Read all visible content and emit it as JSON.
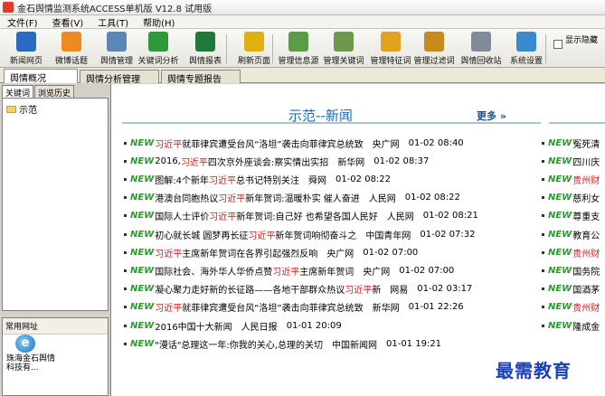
{
  "window": {
    "title": "金石舆情监测系统ACCESS单机版 V12.8 试用版"
  },
  "menu": [
    "文件(F)",
    "查看(V)",
    "工具(T)",
    "帮助(H)"
  ],
  "toolbar": [
    {
      "label": "新闻网页",
      "icon": "s-logo-icon",
      "color": "#2a6ac0"
    },
    {
      "label": "微博话题",
      "icon": "rss-icon",
      "color": "#ef8a1e"
    },
    {
      "label": "舆情管理",
      "icon": "monitor-icon",
      "color": "#5a87b8"
    },
    {
      "label": "关键词分析",
      "icon": "bar-chart-icon",
      "color": "#2e9a3a"
    },
    {
      "label": "舆情报表",
      "icon": "excel-icon",
      "color": "#1f7a3a"
    },
    {
      "label": "刷新页面",
      "icon": "star-icon",
      "color": "#e0b010"
    },
    {
      "label": "管理信息源",
      "icon": "database-icon",
      "color": "#5b9c46"
    },
    {
      "label": "管理关键词",
      "icon": "table-icon",
      "color": "#6b9b4a"
    },
    {
      "label": "管理特征词",
      "icon": "cards-icon",
      "color": "#e3a21c"
    },
    {
      "label": "管理过滤词",
      "icon": "folder-image-icon",
      "color": "#c88a1a"
    },
    {
      "label": "舆情回收站",
      "icon": "trash-icon",
      "color": "#7f8a9a"
    },
    {
      "label": "系统设置",
      "icon": "screen-icon",
      "color": "#3a8ad0"
    }
  ],
  "display_option": {
    "label": "显示隐藏"
  },
  "tabs": [
    "舆情概况",
    "舆情分析管理",
    "舆情专题报告"
  ],
  "left": {
    "tabs": [
      "关键词",
      "浏览历史"
    ],
    "tree": [
      "示范"
    ],
    "common_sites": {
      "title": "常用网址",
      "item": "珠海金石舆情科技有..."
    }
  },
  "main": {
    "heading": "示范--新闻",
    "more": "更多 »",
    "news": [
      {
        "pre": "",
        "hl": "习近平",
        "post": "就菲律宾遭受台风“洛坦”袭击向菲律宾总统致",
        "source": "央广网",
        "time": "01-02 08:40"
      },
      {
        "pre": "2016, ",
        "hl": "习近平",
        "post": "四次京外座谈会:察实情出实招",
        "source": "新华网",
        "time": "01-02 08:37"
      },
      {
        "pre": "图解:4个新年 ",
        "hl": "习近平",
        "post": "总书记特别关注",
        "source": "舜网",
        "time": "01-02 08:22"
      },
      {
        "pre": "港澳台同胞热议",
        "hl": "习近平",
        "post": "新年贺词:温暖朴实 催人奋进",
        "source": "人民网",
        "time": "01-02 08:22"
      },
      {
        "pre": "国际人士评价",
        "hl": "习近平",
        "post": "新年贺词:自己好 也希望各国人民好",
        "source": "人民网",
        "time": "01-02 08:21"
      },
      {
        "pre": "初心就长城 圆梦再长征 ",
        "hl": "习近平",
        "post": "新年贺词响彻奋斗之",
        "source": "中国青年网",
        "time": "01-02 07:32"
      },
      {
        "pre": "",
        "hl": "习近平",
        "post": "主席新年贺词在各界引起强烈反响",
        "source": "央广网",
        "time": "01-02 07:00"
      },
      {
        "pre": "国际社会、海外华人华侨点赞",
        "hl": "习近平",
        "post": "主席新年贺词",
        "source": "央广网",
        "time": "01-02 07:00"
      },
      {
        "pre": "凝心聚力走好新的长征路——各地干部群众热议",
        "hl": "习近平",
        "post": "新",
        "source": "网易",
        "time": "01-02 03:17"
      },
      {
        "pre": "",
        "hl": "习近平",
        "post": "就菲律宾遭受台风“洛坦”袭击向菲律宾总统致",
        "source": "新华网",
        "time": "01-01 22:26"
      },
      {
        "pre": "2016中国十大新闻",
        "hl": "",
        "post": "",
        "source": "人民日报",
        "time": "01-01 20:09"
      },
      {
        "pre": "\"漫话\"总理这一年:你我的关心,总理的关切",
        "hl": "",
        "post": "",
        "source": "中国新闻网",
        "time": "01-01 19:21"
      }
    ],
    "right_news": [
      {
        "pre": "",
        "hl": "",
        "post": "冤死清"
      },
      {
        "pre": "",
        "hl": "",
        "post": "四川庆"
      },
      {
        "pre": "",
        "hl": "贵州财",
        "post": ""
      },
      {
        "pre": "",
        "hl": "",
        "post": "慈利女"
      },
      {
        "pre": "",
        "hl": "",
        "post": "尊重支"
      },
      {
        "pre": "",
        "hl": "",
        "post": "教育公"
      },
      {
        "pre": "",
        "hl": "贵州财",
        "post": ""
      },
      {
        "pre": "",
        "hl": "",
        "post": "国务院"
      },
      {
        "pre": "",
        "hl": "",
        "post": "国酒茅"
      },
      {
        "pre": "",
        "hl": "贵州财",
        "post": ""
      },
      {
        "pre": "",
        "hl": "",
        "post": "隆成金"
      }
    ],
    "new_badge": "NEW"
  },
  "watermark": "最需教育"
}
